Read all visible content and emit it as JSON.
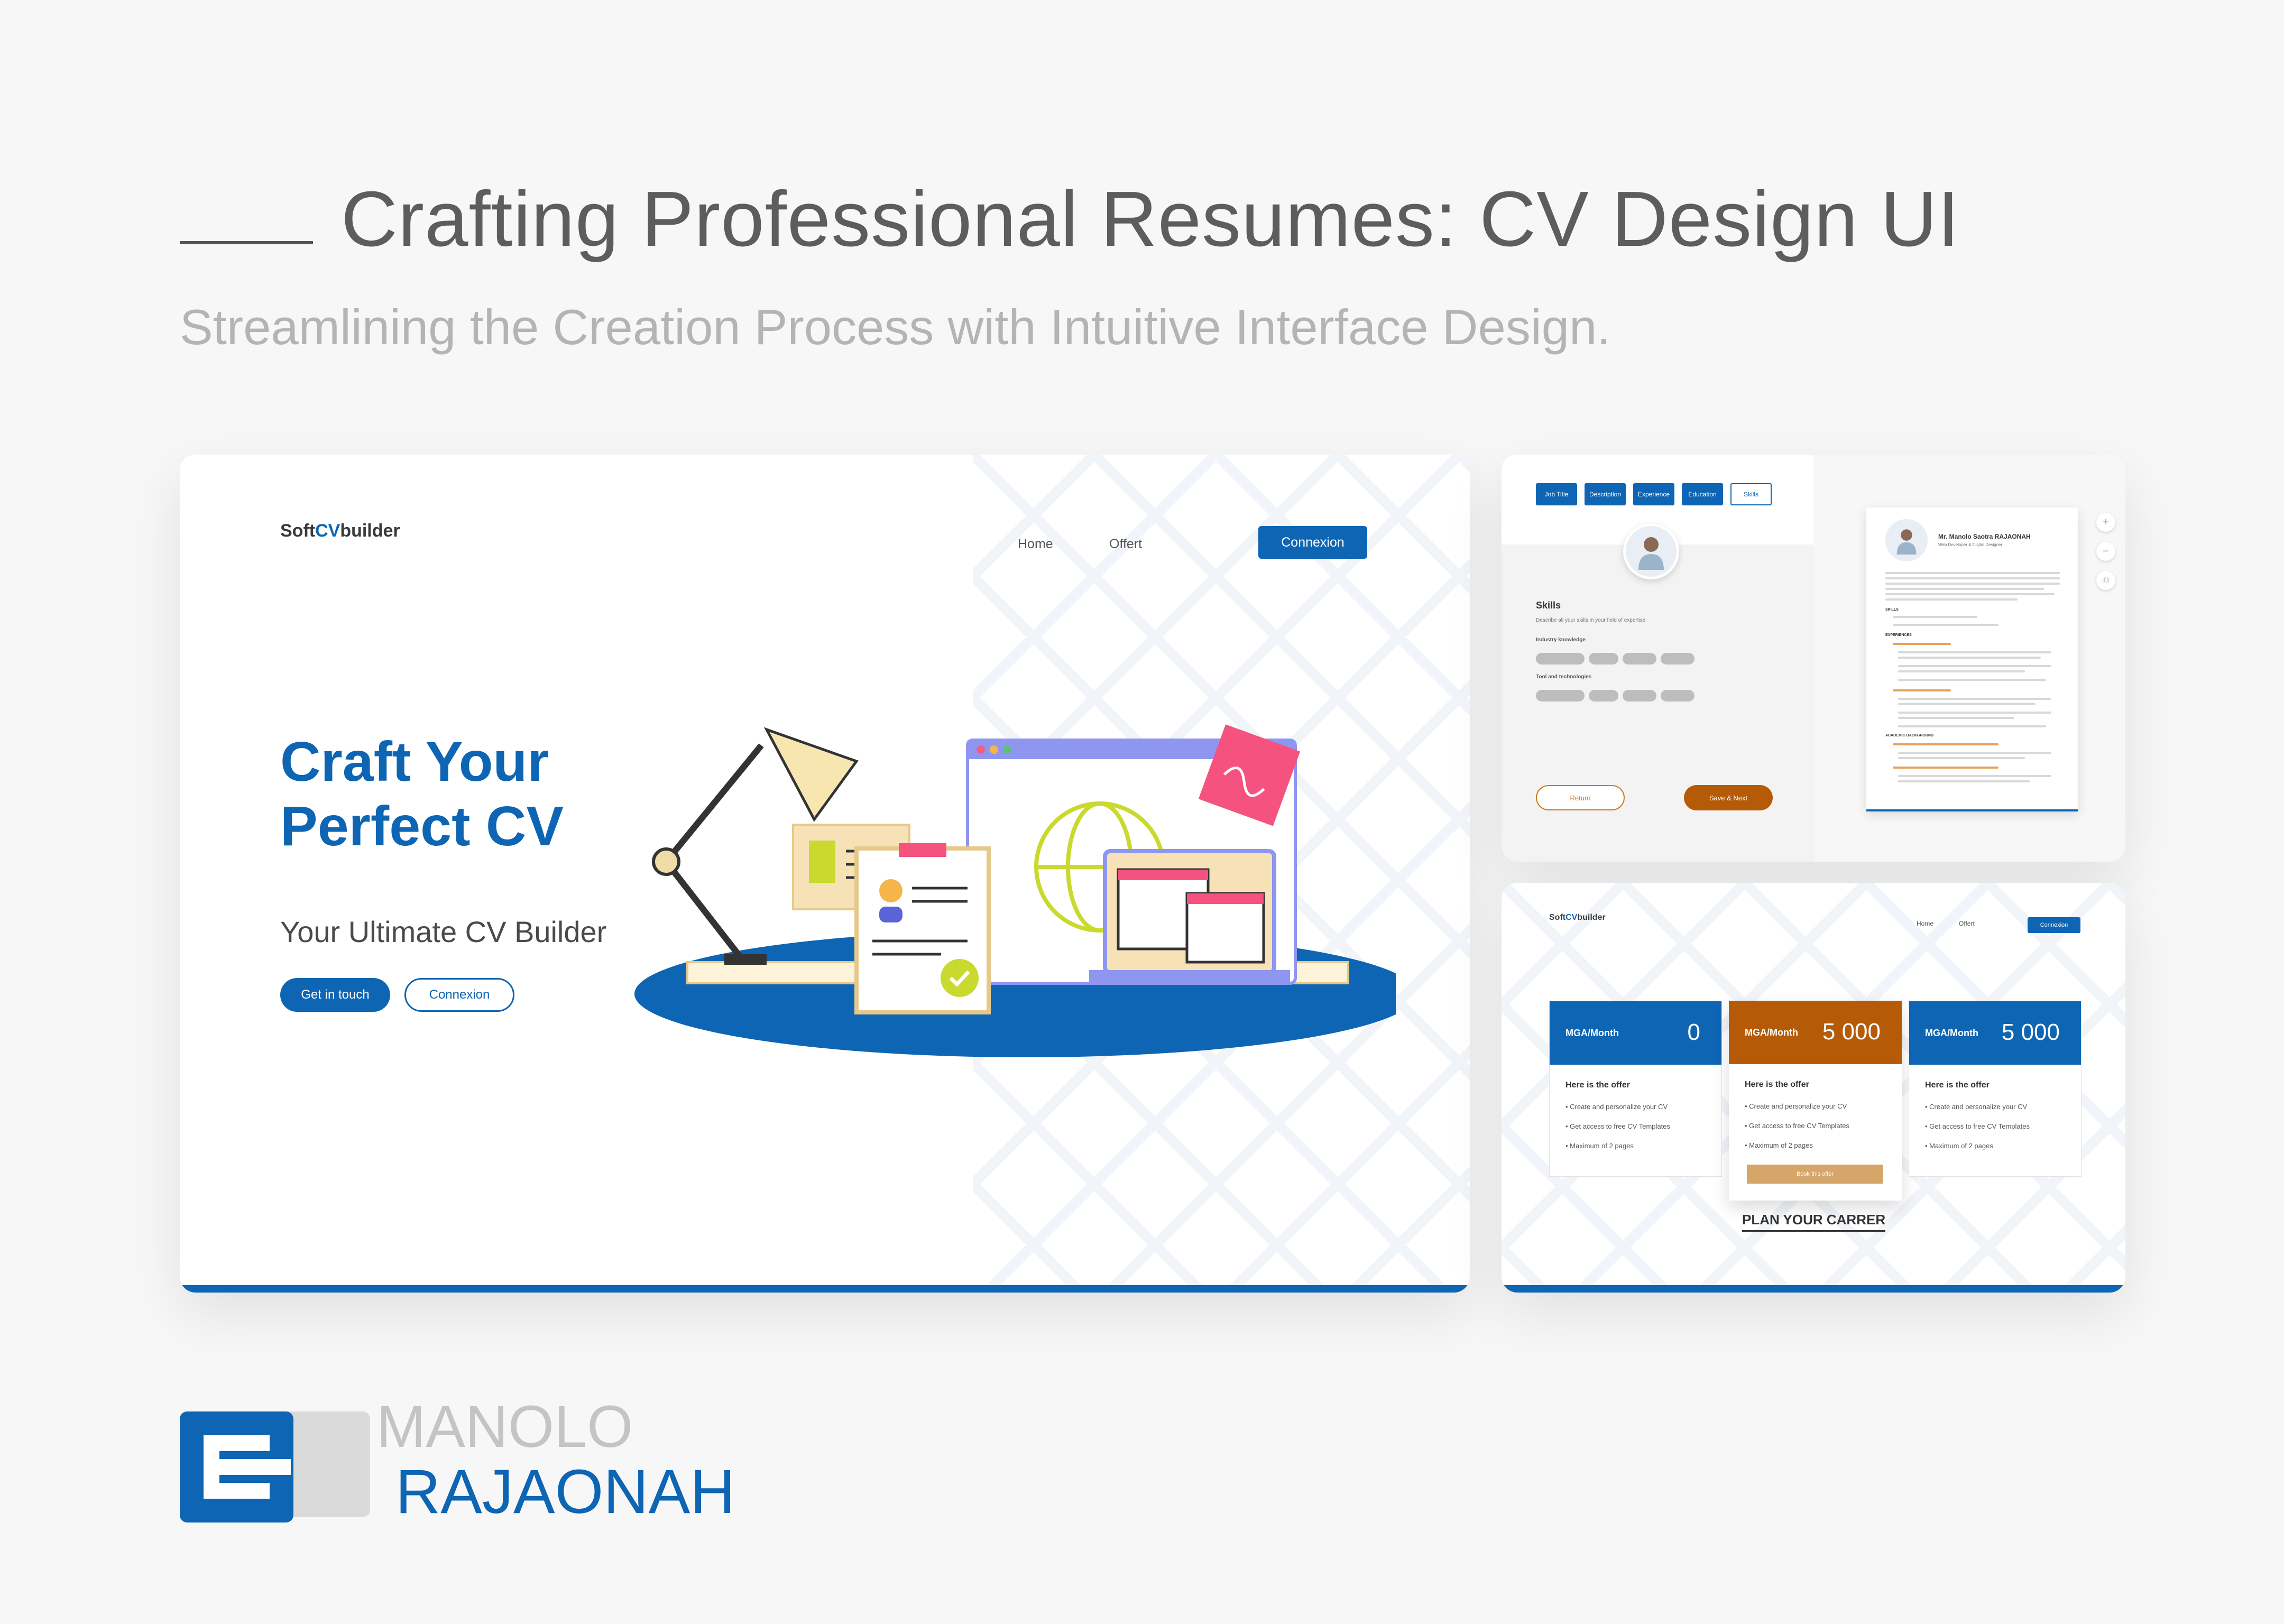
{
  "header": {
    "title": "Crafting Professional Resumes: CV Design UI",
    "subtitle": "Streamlining the Creation Process with Intuitive Interface Design."
  },
  "landing": {
    "logo_prefix": "Soft",
    "logo_cv": "CV",
    "logo_suffix": "builder",
    "nav": [
      "Home",
      "Offert"
    ],
    "connect_label": "Connexion",
    "hero_line1": "Craft Your",
    "hero_line2": "Perfect CV",
    "tagline": "Your Ultimate CV Builder",
    "cta_primary": "Get in touch",
    "cta_secondary": "Connexion"
  },
  "editor": {
    "tabs": [
      "Job Title",
      "Description",
      "Experience",
      "Education",
      "Skills"
    ],
    "active_tab": "Skills",
    "section_title": "Skills",
    "section_hint": "Describe all your skills in your field of expertise",
    "industry_label": "Industry knowledge",
    "tools_label": "Tool and technologies",
    "return_label": "Return",
    "save_label": "Save & Next",
    "preview_name": "Mr. Manolo Saotra RAJAONAH",
    "preview_role": "Web Developer & Digital Designer",
    "preview_sections": [
      "SKILLS",
      "EXPERIENCES",
      "ACADEMIC BACKGROUND"
    ],
    "tools": [
      "+",
      "−",
      "⎙"
    ]
  },
  "pricing": {
    "logo_prefix": "Soft",
    "logo_cv": "CV",
    "logo_suffix": "builder",
    "nav": [
      "Home",
      "Offert"
    ],
    "connect_label": "Connexion",
    "plans": [
      {
        "unit": "MGA/Month",
        "price": "0",
        "offer": "Here is the offer",
        "features": [
          "Create and personalize your CV",
          "Get access to free CV Templates",
          "Maximum of 2 pages"
        ]
      },
      {
        "unit": "MGA/Month",
        "price": "5 000",
        "offer": "Here is the offer",
        "features": [
          "Create and personalize your CV",
          "Get access to free CV Templates",
          "Maximum of 2 pages"
        ],
        "button": "Book this offer"
      },
      {
        "unit": "MGA/Month",
        "price": "5 000",
        "offer": "Here is the offer",
        "features": [
          "Create and personalize your CV",
          "Get access to free CV Templates",
          "Maximum of 2 pages"
        ]
      }
    ],
    "career_label": "PLAN YOUR CARRER"
  },
  "author": {
    "first": "MANOLO",
    "last": "RAJAONAH"
  },
  "colors": {
    "brand_blue": "#0d65b3",
    "accent_orange": "#b55b08",
    "heading_gray": "#5d5d5d"
  }
}
